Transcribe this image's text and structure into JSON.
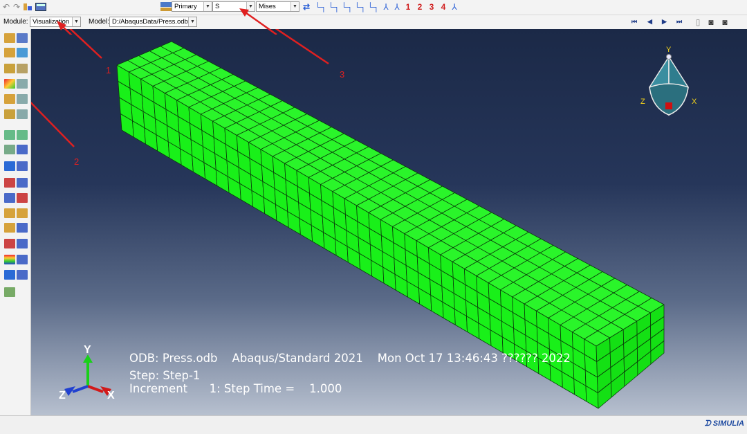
{
  "toolbar": {
    "primary_field": "Primary",
    "variable": "S",
    "invariant": "Mises",
    "step_numbers": [
      "1",
      "2",
      "3",
      "4"
    ]
  },
  "context": {
    "module_label": "Module:",
    "module_value": "Visualization",
    "model_label": "Model:",
    "model_value": "D:/AbaqusData/Press.odb"
  },
  "viewport": {
    "info_line1": "ODB: Press.odb    Abaqus/Standard 2021    Mon Oct 17 13:46:43 ?????? 2022",
    "info_line2": "Step: Step-1",
    "info_line3": "Increment      1: Step Time =    1.000",
    "triad_labels": {
      "y": "Y",
      "z": "Z",
      "x": "X"
    },
    "view_cube_labels": {
      "y": "Y",
      "z": "Z",
      "x": "X"
    },
    "mesh_color": "#19f019"
  },
  "annotations": [
    "1",
    "2",
    "3"
  ],
  "status": {
    "brand": "SIMULIA"
  }
}
